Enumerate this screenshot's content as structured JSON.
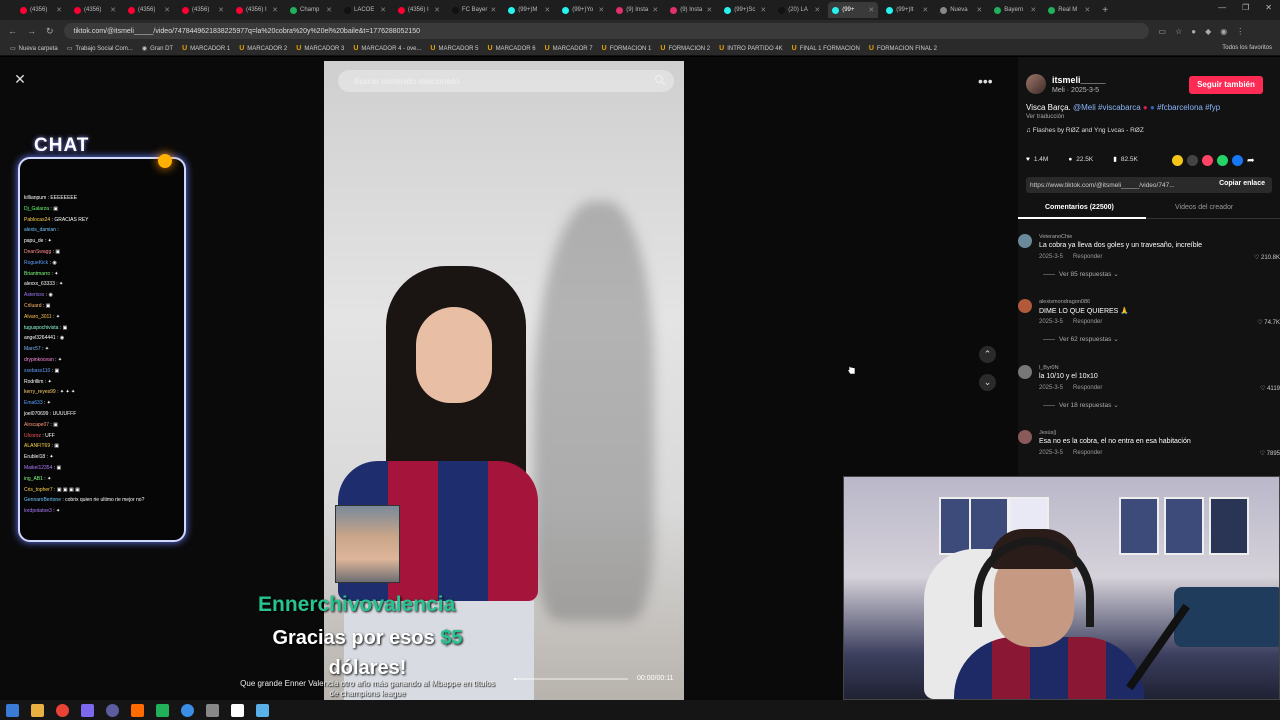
{
  "browser": {
    "tabs": [
      {
        "label": "(4356)",
        "color": "#ff0033",
        "active": false
      },
      {
        "label": "(4356)",
        "color": "#ff0033",
        "active": false
      },
      {
        "label": "(4356)",
        "color": "#ff0033",
        "active": false
      },
      {
        "label": "(4356)",
        "color": "#ff0033",
        "active": false
      },
      {
        "label": "(4356) I",
        "color": "#ff0033",
        "active": false
      },
      {
        "label": "Champ",
        "color": "#20b15a",
        "active": false
      },
      {
        "label": "LACOE",
        "color": "#111111",
        "active": false
      },
      {
        "label": "(4356) I",
        "color": "#ff0033",
        "active": false
      },
      {
        "label": "FC Bayer",
        "color": "#111111",
        "active": false
      },
      {
        "label": "(99+)M",
        "color": "#25f4ee",
        "active": false
      },
      {
        "label": "(99+)Yo",
        "color": "#25f4ee",
        "active": false
      },
      {
        "label": "(9) Insta",
        "color": "#e1306c",
        "active": false
      },
      {
        "label": "(9) Insta",
        "color": "#e1306c",
        "active": false
      },
      {
        "label": "(99+)Sc",
        "color": "#25f4ee",
        "active": false
      },
      {
        "label": "(20) LA",
        "color": "#111111",
        "active": false
      },
      {
        "label": "(99+",
        "color": "#25f4ee",
        "active": true
      },
      {
        "label": "(99+)lt",
        "color": "#25f4ee",
        "active": false
      },
      {
        "label": "Nueva",
        "color": "#888888",
        "active": false
      },
      {
        "label": "Bayern",
        "color": "#20b15a",
        "active": false
      },
      {
        "label": "Real M",
        "color": "#20b15a",
        "active": false
      }
    ],
    "url": "tiktok.com/@itsmeli_____/video/7478449621838225977q=la%20cobra%20y%20el%20baile&t=1776288052150",
    "bookmarks": [
      {
        "label": "Nueva carpeta",
        "type": "folder"
      },
      {
        "label": "Trabajo Social Com...",
        "type": "folder"
      },
      {
        "label": "Gran DT",
        "type": "site"
      },
      {
        "label": "MARCADOR 1",
        "type": "u"
      },
      {
        "label": "MARCADOR 2",
        "type": "u"
      },
      {
        "label": "MARCADOR 3",
        "type": "u"
      },
      {
        "label": "MARCADOR 4 - ove...",
        "type": "u"
      },
      {
        "label": "MARCADOR 5",
        "type": "u"
      },
      {
        "label": "MARCADOR 6",
        "type": "u"
      },
      {
        "label": "MARCADOR 7",
        "type": "u"
      },
      {
        "label": "FORMACION 1",
        "type": "u"
      },
      {
        "label": "FORMACION 2",
        "type": "u"
      },
      {
        "label": "INTRO PARTIDO 4K",
        "type": "u"
      },
      {
        "label": "FINAL 1 FORMACION",
        "type": "u"
      },
      {
        "label": "FORMACION FINAL 2",
        "type": "u"
      }
    ],
    "all_favorites": "Todos los favoritos"
  },
  "chat": {
    "title": "CHAT",
    "lines": [
      {
        "user": "killianpum",
        "color": "#ffffff",
        "msg": "EEEEEEEE"
      },
      {
        "user": "Dj_Galarza",
        "color": "#6cff6c",
        "msg": "▣"
      },
      {
        "user": "Pablocas24",
        "color": "#ffd34d",
        "msg": "GRACIAS REY"
      },
      {
        "user": "alexis_damian",
        "color": "#6ec6ff",
        "msg": ""
      },
      {
        "user": "papu_de",
        "color": "#ffffff",
        "msg": "✦"
      },
      {
        "user": "DeanSwagg",
        "color": "#ff8c8c",
        "msg": "▣"
      },
      {
        "user": "RogueKick",
        "color": "#5aa0ff",
        "msg": "◉"
      },
      {
        "user": "Briantmarro",
        "color": "#7dff7d",
        "msg": "✦"
      },
      {
        "user": "alexxx_63333",
        "color": "#ffffff",
        "msg": "✦"
      },
      {
        "user": "Asterixsx",
        "color": "#9f7bff",
        "msg": "◉"
      },
      {
        "user": "Criluard",
        "color": "#ffb86b",
        "msg": "▣"
      },
      {
        "user": "Alvaro_3011",
        "color": "#ffc04d",
        "msg": "✦"
      },
      {
        "user": "tuguspochivista",
        "color": "#8affd0",
        "msg": "▣"
      },
      {
        "user": "angel3264441",
        "color": "#ffffff",
        "msg": "◉"
      },
      {
        "user": "Marc57",
        "color": "#7db8ff",
        "msg": "✦"
      },
      {
        "user": "drypinkocean",
        "color": "#ff8ce0",
        "msg": "✦"
      },
      {
        "user": "xsebasx110",
        "color": "#60a0ff",
        "msg": "▣"
      },
      {
        "user": "Rodrillim",
        "color": "#ffffff",
        "msg": "✦"
      },
      {
        "user": "kerry_reyes99",
        "color": "#ffd36b",
        "msg": "✦ ✦ ✦"
      },
      {
        "user": "Ema633",
        "color": "#5aa0ff",
        "msg": "✦"
      },
      {
        "user": "joel070699",
        "color": "#ffffff",
        "msg": "UUUUFFF"
      },
      {
        "user": "Airscape07",
        "color": "#ff9b7b",
        "msg": "▣"
      },
      {
        "user": "Ulcoroz",
        "color": "#ff5a5a",
        "msg": "UFF"
      },
      {
        "user": "ALANFIT69",
        "color": "#ffd34d",
        "msg": "▣"
      },
      {
        "user": "Erublel18",
        "color": "#ffffff",
        "msg": "✦"
      },
      {
        "user": "Maikel12354",
        "color": "#b07bff",
        "msg": "▣"
      },
      {
        "user": "ing_AB1",
        "color": "#7dff7d",
        "msg": "✦"
      },
      {
        "user": "Cris_topher7",
        "color": "#ffd34d",
        "msg": "▣ ▣ ▣ ▣"
      },
      {
        "user": "GennaroBertone",
        "color": "#6ec6ff",
        "msg": "cobrix quien rie ultimo rie mejor no?"
      },
      {
        "user": "lordpotatoe3",
        "color": "#b07bff",
        "msg": "✦"
      }
    ]
  },
  "video": {
    "search_placeholder": "Buscar contenido relacionado",
    "timecode": "00:00/00:11",
    "progress_fraction": 0.02
  },
  "donation": {
    "donor": "Ennerchivovalencia",
    "msg_prefix": "Gracias por esos ",
    "amount": "$5",
    "msg_suffix": "dólares!",
    "sub": "Que grande Enner Valencia otro año más ganando al Mbappe en títulos de champions league"
  },
  "post": {
    "username": "itsmeli_____",
    "sub": "Meli · 2025-3-5",
    "follow_label": "Seguir también",
    "desc_text": "Visca Barça. ",
    "desc_tags": "@Meli #viscabarca",
    "desc_tags2": " #fcbarcelona #fyp",
    "translate": "Ver traducción",
    "music": "♫  Flashes by RØZ and Yng Lvcas - RØZ",
    "likes": "1.4M",
    "comments_count": "22.5K",
    "saves": "82.5K",
    "link": "https://www.tiktok.com/@itsmeli_____/video/747...",
    "copy_label": "Copiar enlace",
    "tab_comments": "Comentarios (22500)",
    "tab_creator": "Videos del creador"
  },
  "comments": [
    {
      "user": "VeteranoChie",
      "text": "La cobra ya lleva dos goles y un travesaño, increíble",
      "date": "2025-3-5",
      "reply": "Responder",
      "likes": "♡ 210.8K",
      "replies": "Ver 85 respuestas ⌄",
      "avatar": "#6a8a9a"
    },
    {
      "user": "alexismondragon086",
      "text": "DIME LO QUE QUIERES 🙏",
      "date": "2025-3-5",
      "reply": "Responder",
      "likes": "♡ 74.7K",
      "replies": "Ver 62 respuestas ⌄",
      "avatar": "#b05a3a"
    },
    {
      "user": "l_Byr0N",
      "text": "la 10/10 y el 10x10",
      "date": "2025-3-5",
      "reply": "Responder",
      "likes": "♡ 4119",
      "replies": "Ver 18 respuestas ⌄",
      "avatar": "#777777"
    },
    {
      "user": "Jesús||",
      "text": "Esa no es la cobra, el no entra en esa habitación",
      "date": "2025-3-5",
      "reply": "Responder",
      "likes": "♡ 7895",
      "replies": "",
      "avatar": "#8a5a5a"
    }
  ],
  "icons": {
    "close": "close-icon",
    "more": "more-icon",
    "up": "chevron-up-icon",
    "down": "chevron-down-icon"
  }
}
